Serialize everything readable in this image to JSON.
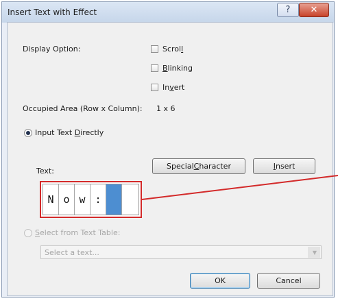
{
  "dialog": {
    "title": "Insert Text with Effect",
    "help_glyph": "?",
    "close_glyph": "✕"
  },
  "display_option": {
    "label": "Display Option:",
    "options": [
      {
        "label_pre": "Scrol",
        "mnemonic": "l",
        "label_post": "",
        "checked": false
      },
      {
        "label_pre": "",
        "mnemonic": "B",
        "label_post": "linking",
        "checked": false
      },
      {
        "label_pre": "In",
        "mnemonic": "v",
        "label_post": "ert",
        "checked": false
      }
    ]
  },
  "occupied_area": {
    "label": "Occupied Area (Row x Column):",
    "value": "1 x 6"
  },
  "input_direct": {
    "label_pre": "Input Text ",
    "mnemonic": "D",
    "label_post": "irectly",
    "selected": true
  },
  "text_field": {
    "label": "Text:",
    "cells": [
      "N",
      "o",
      "w",
      ":",
      "",
      ""
    ],
    "cursor_index": 4
  },
  "buttons": {
    "special_pre": "Special ",
    "special_mnemonic": "C",
    "special_post": "haracter",
    "insert_pre": "",
    "insert_mnemonic": "I",
    "insert_post": "nsert",
    "ok": "OK",
    "cancel": "Cancel"
  },
  "text_table": {
    "label_pre": "",
    "mnemonic": "S",
    "label_post": "elect from Text Table:",
    "selected": false,
    "placeholder": "Select a text..."
  },
  "colors": {
    "callout": "#d32a2a",
    "cursor_cell": "#4d8ed1"
  }
}
